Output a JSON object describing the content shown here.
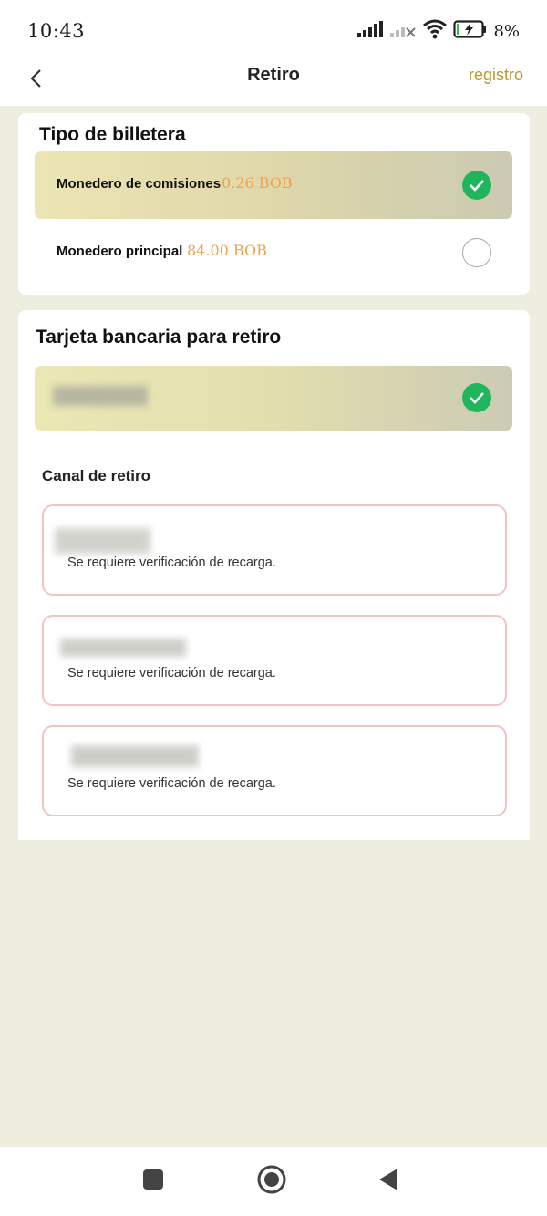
{
  "status_bar": {
    "time": "10:43",
    "battery_text": "8%",
    "icons": [
      "signal-icon",
      "signal-x-icon",
      "wifi-icon",
      "battery-charging-icon"
    ]
  },
  "header": {
    "title": "Retiro",
    "record_label": "registro",
    "back_icon": "chevron-left-icon"
  },
  "wallet_section": {
    "title": "Tipo de billetera",
    "options": [
      {
        "name": "Monedero de comisiones",
        "amount": "0.26 BOB",
        "selected": true
      },
      {
        "name": "Monedero principal",
        "amount": "84.00 BOB",
        "selected": false
      }
    ]
  },
  "bank_section": {
    "title": "Tarjeta bancaria para retiro",
    "selected": true
  },
  "channel_section": {
    "title": "Canal de retiro",
    "items": [
      {
        "note": "Se requiere verificación de recarga."
      },
      {
        "note": "Se requiere verificación de recarga."
      },
      {
        "note": "Se requiere verificación de recarga."
      }
    ]
  },
  "colors": {
    "background": "#edeee0",
    "accent_gold": "#b99a2e",
    "amount_orange": "#f0a24a",
    "check_green": "#1fb55c",
    "channel_border": "#f1c3c3"
  },
  "nav_bar": {
    "icons": [
      "square-icon",
      "circle-home-icon",
      "triangle-back-icon"
    ]
  }
}
